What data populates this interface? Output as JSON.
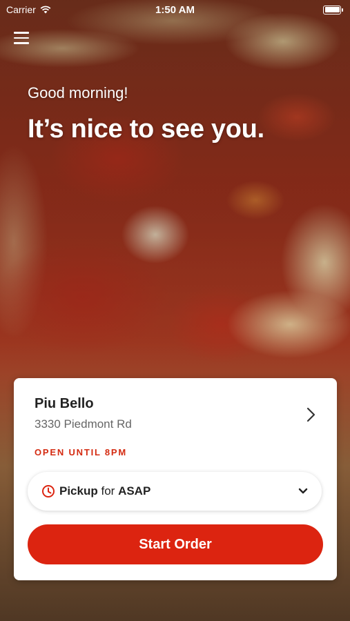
{
  "status_bar": {
    "carrier": "Carrier",
    "time": "1:50 AM",
    "battery_level": 1.0
  },
  "header": {
    "menu_icon": "hamburger-menu-icon",
    "greeting": "Good morning!",
    "headline": "It’s nice to see you."
  },
  "location_card": {
    "restaurant_name": "Piu Bello",
    "address": "3330 Piedmont Rd",
    "hours_status": "OPEN UNTIL 8PM",
    "order_mode": {
      "icon": "clock-icon",
      "method": "Pickup",
      "connector": "for",
      "timing": "ASAP"
    },
    "start_order_label": "Start Order"
  },
  "colors": {
    "accent": "#dc2410",
    "hours_text": "#d42a10"
  }
}
